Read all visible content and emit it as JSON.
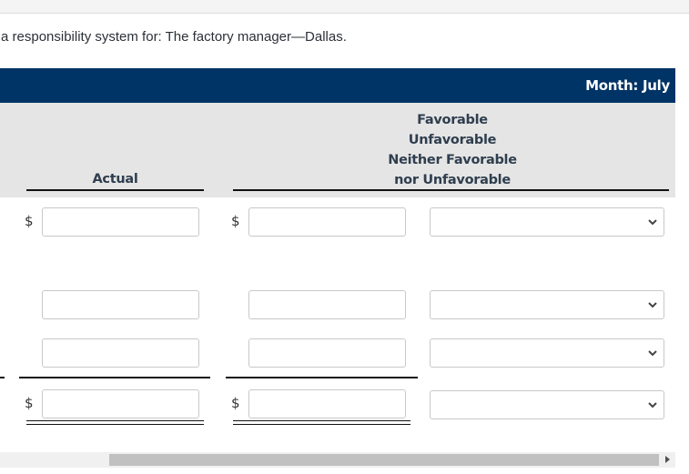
{
  "instruction": "a responsibility system for: The factory manager—Dallas.",
  "header": {
    "month_label": "Month: July"
  },
  "columns": {
    "actual": "Actual",
    "status_lines": [
      "Favorable",
      "Unfavorable",
      "Neither Favorable",
      "nor Unfavorable"
    ]
  },
  "currency_symbol": "$",
  "rows": [
    {
      "actual_value": "",
      "budget_value": "",
      "status_selected": "",
      "show_dollar": true
    },
    {
      "actual_value": "",
      "budget_value": "",
      "status_selected": "",
      "show_dollar": false
    },
    {
      "actual_value": "",
      "budget_value": "",
      "status_selected": "",
      "show_dollar": false
    },
    {
      "actual_value": "",
      "budget_value": "",
      "status_selected": "",
      "show_dollar": true,
      "total": true
    }
  ],
  "icons": {
    "select_chevron": "chevron-down-icon",
    "scroll_right": "triangle-right-icon"
  }
}
